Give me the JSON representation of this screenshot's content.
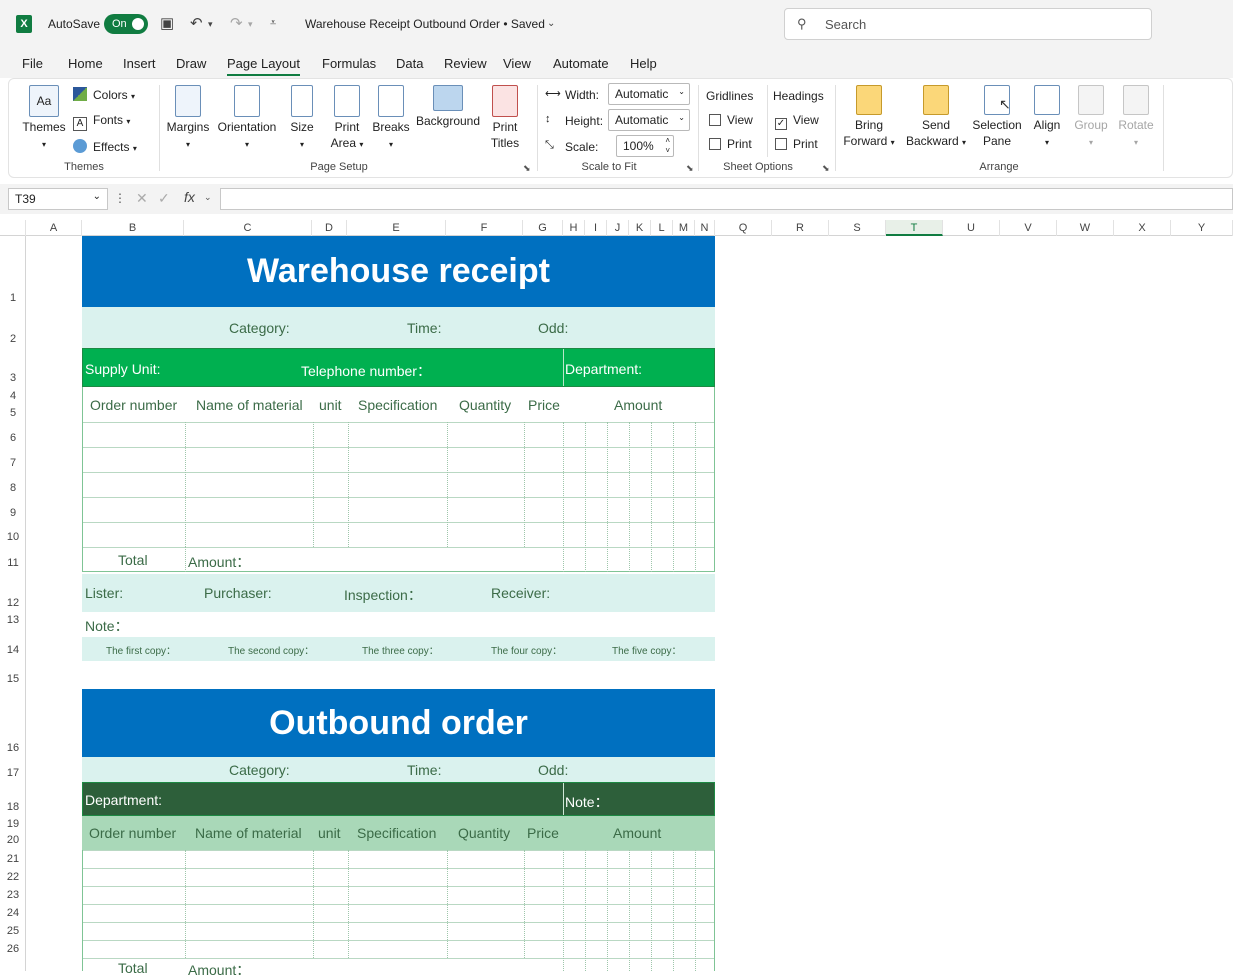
{
  "titlebar": {
    "app_icon": "X",
    "autosave_label": "AutoSave",
    "autosave_state": "On",
    "doc_title": "Warehouse Receipt Outbound Order • Saved",
    "search_placeholder": "Search"
  },
  "menu": {
    "tabs": [
      "File",
      "Home",
      "Insert",
      "Draw",
      "Page Layout",
      "Formulas",
      "Data",
      "Review",
      "View",
      "Automate",
      "Help"
    ],
    "active": "Page Layout"
  },
  "ribbon": {
    "themes": {
      "themes": "Themes",
      "colors": "Colors",
      "fonts": "Fonts",
      "effects": "Effects",
      "group": "Themes"
    },
    "page_setup": {
      "margins": "Margins",
      "orientation": "Orientation",
      "size": "Size",
      "print_area_1": "Print",
      "print_area_2": "Area",
      "breaks": "Breaks",
      "background": "Background",
      "print_titles_1": "Print",
      "print_titles_2": "Titles",
      "group": "Page Setup"
    },
    "scale": {
      "width_label": "Width:",
      "width_value": "Automatic",
      "height_label": "Height:",
      "height_value": "Automatic",
      "scale_label": "Scale:",
      "scale_value": "100%",
      "group": "Scale to Fit"
    },
    "sheet_options": {
      "gridlines": "Gridlines",
      "headings": "Headings",
      "view": "View",
      "print": "Print",
      "gridlines_view": false,
      "gridlines_print": false,
      "headings_view": true,
      "headings_print": false,
      "group": "Sheet Options"
    },
    "arrange": {
      "bring_1": "Bring",
      "bring_2": "Forward",
      "send_1": "Send",
      "send_2": "Backward",
      "selection_1": "Selection",
      "selection_2": "Pane",
      "align": "Align",
      "group_btn": "Group",
      "rotate": "Rotate",
      "group": "Arrange"
    }
  },
  "formula_bar": {
    "name_box": "T39",
    "fx": "fx",
    "value": ""
  },
  "columns": [
    "A",
    "B",
    "C",
    "D",
    "E",
    "F",
    "G",
    "H",
    "I",
    "J",
    "K",
    "L",
    "M",
    "N",
    "Q",
    "R",
    "S",
    "T",
    "U",
    "V",
    "W",
    "X",
    "Y"
  ],
  "selected_column": "T",
  "rows": [
    "1",
    "2",
    "3",
    "4",
    "5",
    "6",
    "7",
    "8",
    "9",
    "10",
    "11",
    "12",
    "13",
    "14",
    "15",
    "16",
    "17",
    "18",
    "19",
    "20",
    "21",
    "22",
    "23",
    "24",
    "25",
    "26"
  ],
  "receipt": {
    "title": "Warehouse receipt",
    "category": "Category:",
    "time": "Time:",
    "odd": "Odd:",
    "supply_unit": "Supply Unit:",
    "telephone": "Telephone number：",
    "department": "Department:",
    "headers": [
      "Order number",
      "Name of material",
      "unit",
      "Specification",
      "Quantity",
      "Price",
      "Amount"
    ],
    "total": "Total",
    "amount": "Amount：",
    "lister": "Lister:",
    "purchaser": "Purchaser:",
    "inspection": "Inspection：",
    "receiver": "Receiver:",
    "note": "Note：",
    "copies": [
      "The first copy：",
      "The second copy：",
      "The three copy：",
      "The four copy：",
      "The five copy："
    ]
  },
  "outbound": {
    "title": "Outbound order",
    "category": "Category:",
    "time": "Time:",
    "odd": "Odd:",
    "department": "Department:",
    "note": "Note：",
    "headers": [
      "Order number",
      "Name of material",
      "unit",
      "Specification",
      "Quantity",
      "Price",
      "Amount"
    ],
    "total": "Total",
    "amount": "Amount："
  },
  "colors": {
    "excel_green": "#107c41",
    "title_blue": "#0070c0",
    "mint": "#daf2ee",
    "green": "#00b050",
    "dark_green": "#2d5f3a",
    "light_green": "#a9d8b8"
  }
}
